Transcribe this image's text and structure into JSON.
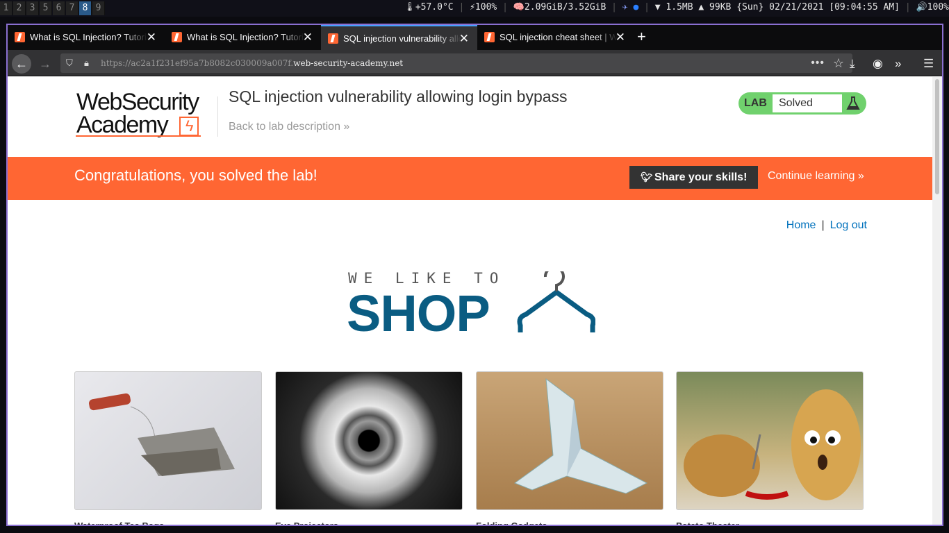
{
  "desktop": {
    "workspaces": [
      "1",
      "2",
      "3",
      "5",
      "6",
      "7",
      "8",
      "9"
    ],
    "active_workspace": "8",
    "temperature": "🌡+57.0°C",
    "battery": "⚡100%",
    "memory": "🧠2.09GiB/3.52GiB",
    "net_down": "▼ 1.5MB",
    "net_up": "▲  99KB",
    "datetime": "{Sun} 02/21/2021 [09:04:55 AM]",
    "volume": "🔊100%"
  },
  "browser": {
    "tabs": [
      {
        "title": "What is SQL Injection? Tutorial & Examples"
      },
      {
        "title": "What is SQL Injection? Tutorial & Examples"
      },
      {
        "title": "SQL injection vulnerability allowing login bypass"
      },
      {
        "title": "SQL injection cheat sheet | Web Security Academy"
      }
    ],
    "active_tab": 2,
    "url_prefix": "https://ac2a1f231ef95a7b8082c030009a007f.",
    "url_domain": "web-security-academy.net"
  },
  "page": {
    "logo_line1": "WebSecurity",
    "logo_line2": "Academy",
    "lab_title": "SQL injection vulnerability allowing login bypass",
    "back_link": "Back to lab description »",
    "lab_label": "LAB",
    "lab_status": "Solved",
    "congrats": "Congratulations, you solved the lab!",
    "share_label": "Share your skills!",
    "continue_label": "Continue learning »",
    "nav": {
      "home": "Home",
      "logout": "Log out"
    },
    "shop_small": "WE LIKE TO",
    "shop_big": "SHOP",
    "products": [
      {
        "name": "Waterproof Tea Bags"
      },
      {
        "name": "Eye Projectors"
      },
      {
        "name": "Folding Gadgets"
      },
      {
        "name": "Potato Theater"
      }
    ]
  },
  "colors": {
    "brand": "#ff6633",
    "solved_badge": "#70d16d",
    "link": "#0071bc",
    "shop_blue": "#0a5c82"
  }
}
